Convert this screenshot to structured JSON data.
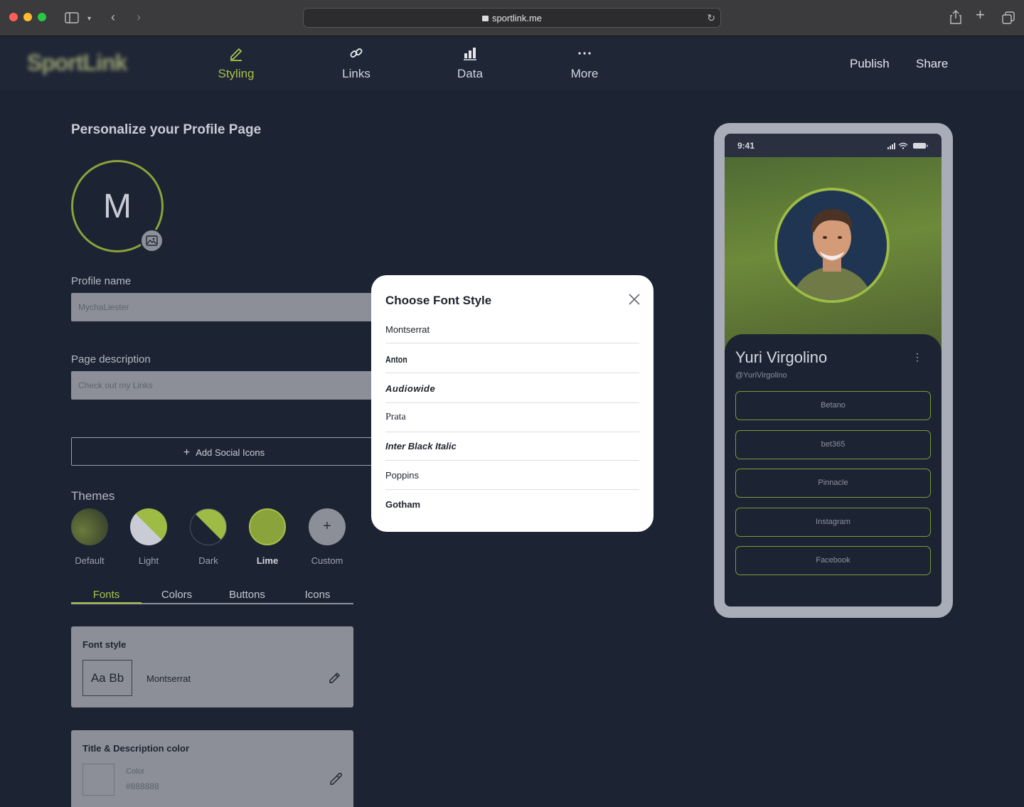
{
  "browser": {
    "url": "sportlink.me"
  },
  "app": {
    "logo": "SportLink",
    "nav": [
      {
        "label": "Styling",
        "icon": "pencil-icon",
        "active": true
      },
      {
        "label": "Links",
        "icon": "link-icon",
        "active": false
      },
      {
        "label": "Data",
        "icon": "bar-chart-icon",
        "active": false
      },
      {
        "label": "More",
        "icon": "more-dots-icon",
        "active": false
      }
    ],
    "actions": {
      "publish": "Publish",
      "share": "Share"
    },
    "accent": "#a6c24a"
  },
  "profile": {
    "section_title": "Personalize your Profile Page",
    "avatar_initial": "M",
    "name_label": "Profile name",
    "name_value": "MychaLiester",
    "description_label": "Page description",
    "description_value": "Check out my Links",
    "add_social": "Add Social Icons"
  },
  "themes": {
    "title": "Themes",
    "items": [
      {
        "label": "Default"
      },
      {
        "label": "Light"
      },
      {
        "label": "Dark"
      },
      {
        "label": "Lime",
        "active": true
      },
      {
        "label": "Custom"
      }
    ]
  },
  "subtabs": [
    "Fonts",
    "Colors",
    "Buttons",
    "Icons"
  ],
  "font_card": {
    "title": "Font style",
    "sample": "Aa Bb",
    "current": "Montserrat"
  },
  "color_card": {
    "title": "Title & Description color",
    "label": "Color",
    "value": "#888888"
  },
  "modal": {
    "title": "Choose Font Style",
    "fonts": [
      "Montserrat",
      "Anton",
      "Audiowide",
      "Prata",
      "Inter Black Italic",
      "Poppins",
      "Gotham"
    ]
  },
  "preview": {
    "time": "9:41",
    "name": "Yuri Virgolino",
    "handle": "@YuriVirgolino",
    "links": [
      "Betano",
      "bet365",
      "Pinnacle",
      "Instagram",
      "Facebook"
    ]
  }
}
